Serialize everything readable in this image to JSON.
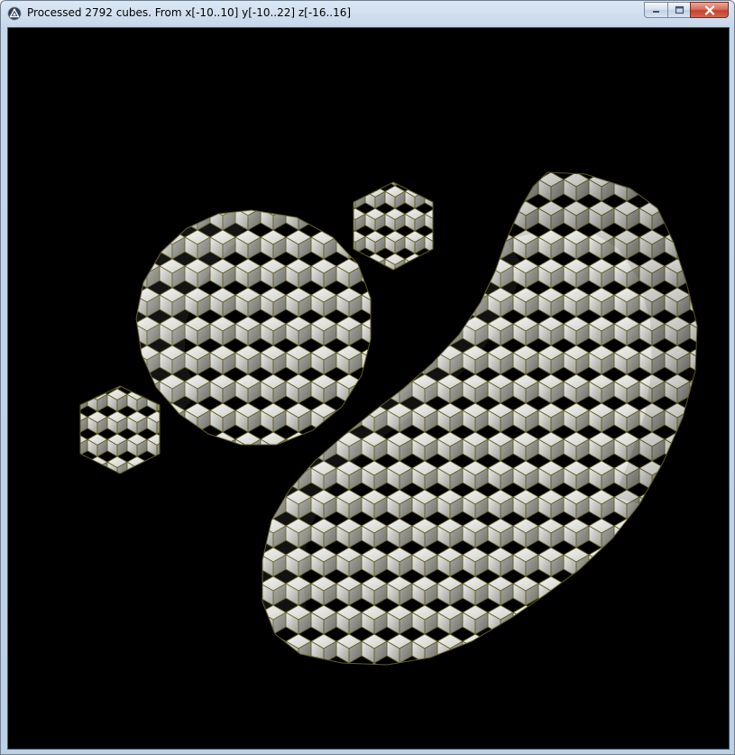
{
  "window": {
    "title": "Processed 2792 cubes. From x[-10..10] y[-10..22] z[-16..16]",
    "icon": "app-logo-icon",
    "controls": {
      "minimize_icon": "minimize-icon",
      "maximize_icon": "maximize-icon",
      "close_icon": "close-icon"
    }
  },
  "scene": {
    "background": "#000000",
    "cube_face_colors": [
      "#e4e4e2",
      "#b8b8b2",
      "#8c8c86"
    ],
    "cube_edge_color": "#6b6a2a"
  }
}
